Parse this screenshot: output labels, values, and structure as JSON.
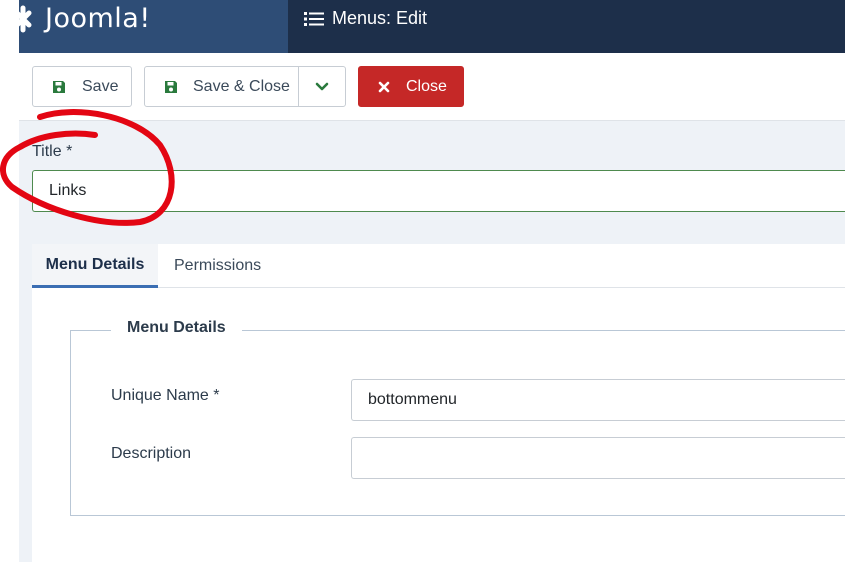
{
  "header": {
    "brand": "Joomla!",
    "page_title": "Menus: Edit"
  },
  "toolbar": {
    "save_label": "Save",
    "save_close_label": "Save & Close",
    "close_label": "Close"
  },
  "form": {
    "title_label": "Title *",
    "title_value": "Links"
  },
  "tabs": [
    {
      "label": "Menu Details",
      "active": true
    },
    {
      "label": "Permissions",
      "active": false
    }
  ],
  "details": {
    "legend": "Menu Details",
    "unique_name_label": "Unique Name *",
    "unique_name_value": "bottommenu",
    "description_label": "Description",
    "description_value": ""
  },
  "colors": {
    "header_bg": "#1d2f4a",
    "brand_bg": "#2e4d76",
    "close_button": "#c52827",
    "save_icon": "#2a7a3d",
    "title_border": "#4e8a4e",
    "active_tab_border": "#3b6eb3",
    "annotation": "#e30613"
  },
  "icons": {
    "logo": "joomla-logo-icon",
    "menu": "list-icon",
    "save": "floppy-disk-icon",
    "dropdown": "chevron-down-icon",
    "close": "x-icon"
  }
}
